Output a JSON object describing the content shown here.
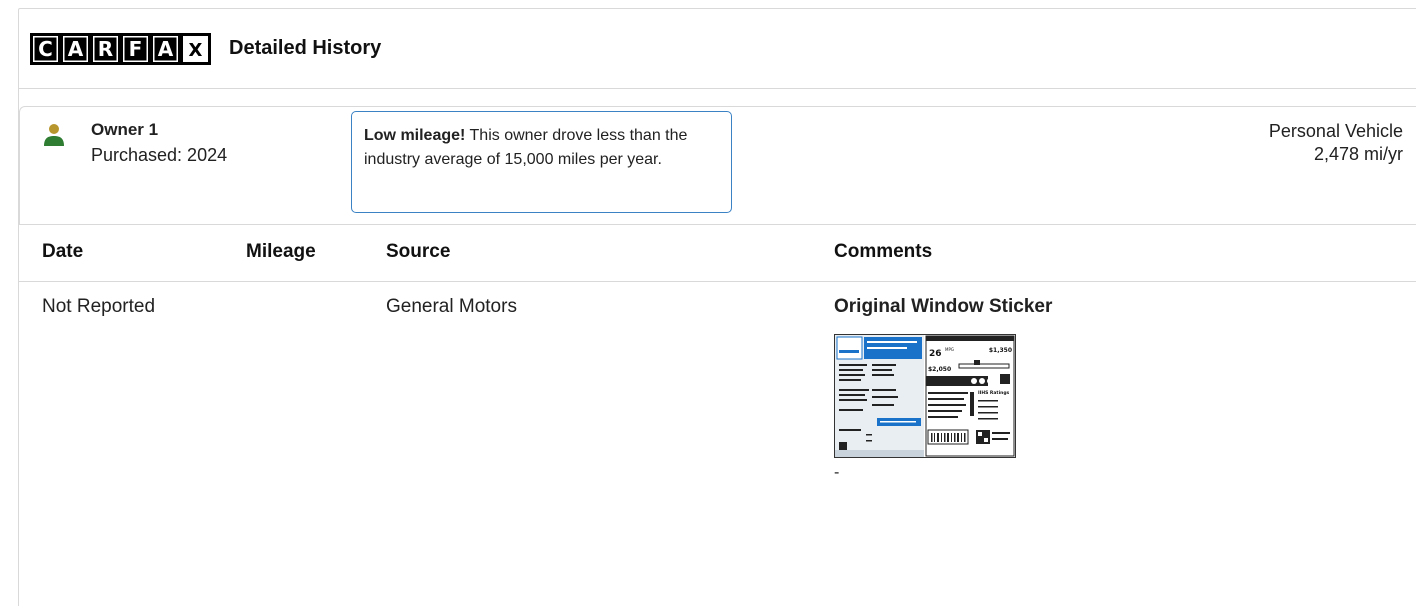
{
  "brand": {
    "logo_letters": [
      "C",
      "A",
      "R",
      "F",
      "A",
      "X"
    ],
    "logo_icon": "carfax-logo"
  },
  "header": {
    "title": "Detailed History"
  },
  "owner": {
    "name": "Owner 1",
    "purchased": "Purchased: 2024",
    "callout_bold": "Low mileage!",
    "callout_text": " This owner drove less than the industry average of 15,000 miles per year.",
    "use_type": "Personal Vehicle",
    "mileage_rate": "2,478 mi/yr",
    "icon": "person-icon",
    "colors": {
      "person_head": "#b8962e",
      "person_body": "#2e7d32",
      "callout_border": "#3b82c4"
    }
  },
  "table": {
    "headers": {
      "date": "Date",
      "mileage": "Mileage",
      "source": "Source",
      "comments": "Comments"
    },
    "rows": [
      {
        "date": "Not Reported",
        "mileage": "",
        "source": "General Motors",
        "comment_title": "Original Window Sticker",
        "comment_extra": "-"
      }
    ]
  },
  "sticker": {
    "mpg": "26",
    "mpg_unit": "MPG",
    "price1": "$1,350",
    "price2": "$2,050",
    "ratings_label": "IIHS Ratings"
  }
}
